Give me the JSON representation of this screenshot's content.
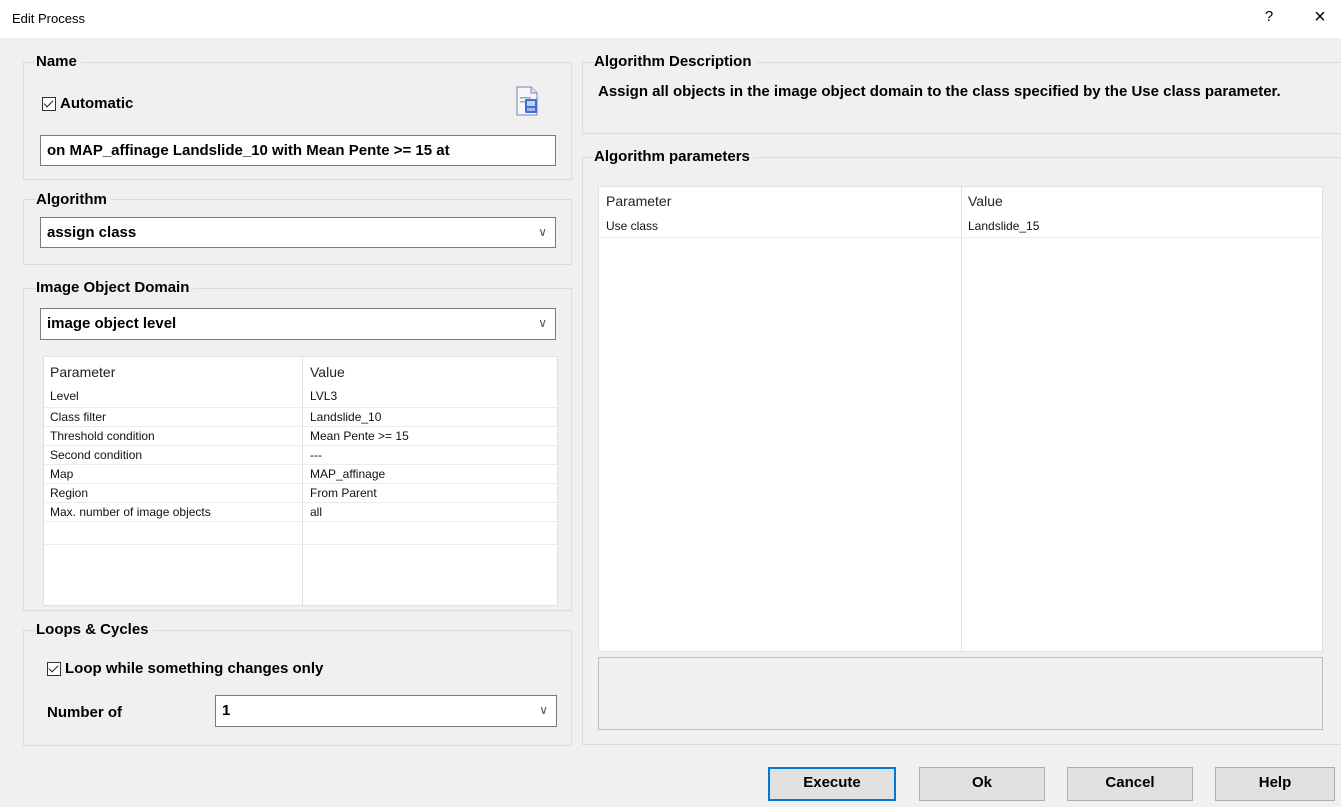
{
  "window": {
    "title": "Edit Process",
    "help_glyph": "?",
    "close_glyph": "×"
  },
  "name_group": {
    "legend": "Name",
    "automatic_label": "Automatic",
    "automatic_checked": true,
    "value": "on MAP_affinage Landslide_10 with Mean Pente >= 15  at"
  },
  "algorithm_group": {
    "legend": "Algorithm",
    "selected": "assign class"
  },
  "domain_group": {
    "legend": "Image Object Domain",
    "selected": "image object level",
    "headers": {
      "parameter": "Parameter",
      "value": "Value"
    },
    "rows": [
      {
        "parameter": "Level",
        "value": "LVL3"
      },
      {
        "parameter": "Class filter",
        "value": "Landslide_10"
      },
      {
        "parameter": "Threshold condition",
        "value": "Mean Pente >= 15"
      },
      {
        "parameter": "Second condition",
        "value": "---"
      },
      {
        "parameter": "Map",
        "value": "MAP_affinage"
      },
      {
        "parameter": "Region",
        "value": "From Parent"
      },
      {
        "parameter": "Max. number of image objects",
        "value": "all"
      }
    ]
  },
  "loops_group": {
    "legend": "Loops & Cycles",
    "loop_label": "Loop while something changes only",
    "loop_checked": true,
    "number_label": "Number of",
    "number_value": "1"
  },
  "description_group": {
    "legend": "Algorithm Description",
    "text": "Assign all objects in the image object domain to the class specified by the Use class parameter."
  },
  "params_group": {
    "legend": "Algorithm parameters",
    "headers": {
      "parameter": "Parameter",
      "value": "Value"
    },
    "rows": [
      {
        "parameter": "Use class",
        "value": "Landslide_15"
      }
    ]
  },
  "buttons": {
    "execute": "Execute",
    "ok": "Ok",
    "cancel": "Cancel",
    "help": "Help"
  },
  "icons": {
    "name_edit": "document-edit-icon",
    "dropdown": "chevron-down-icon",
    "help": "help-icon",
    "close": "close-icon"
  },
  "colors": {
    "default_button_border": "#0078d7",
    "background": "#f0f0f0"
  }
}
